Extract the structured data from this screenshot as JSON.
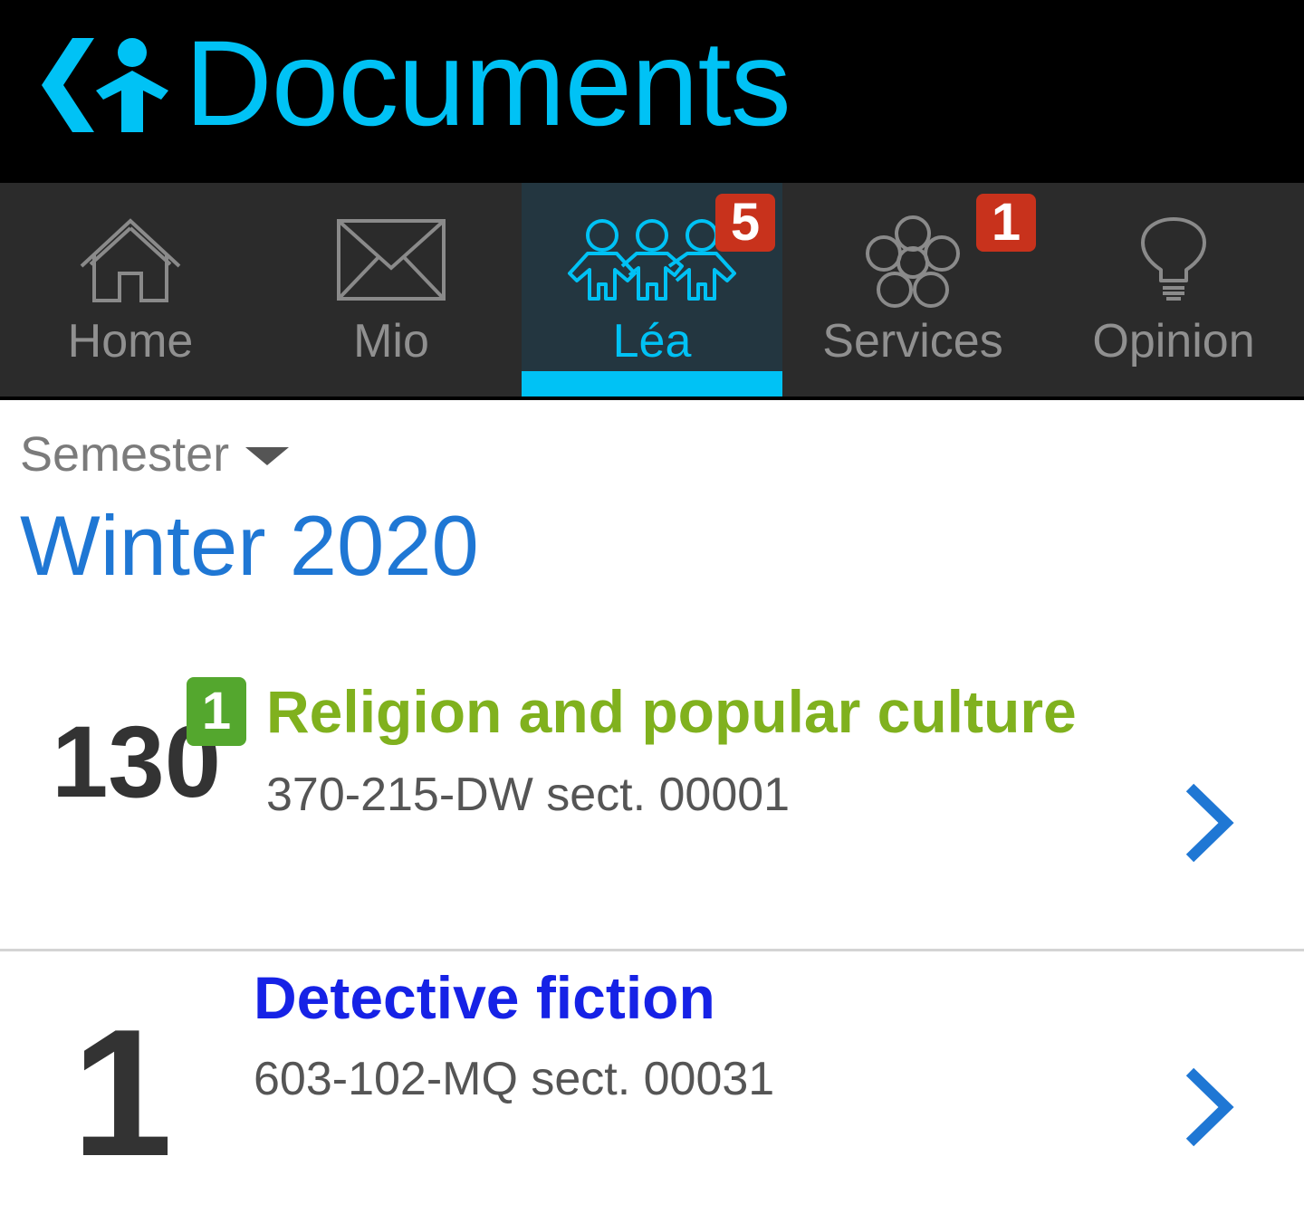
{
  "header": {
    "title": "Documents",
    "logo_icon": "omnivox-logo-icon",
    "title_color": "#00c2f5"
  },
  "tabs": [
    {
      "label": "Home",
      "icon": "house-icon",
      "active": false,
      "badge": null
    },
    {
      "label": "Mio",
      "icon": "envelope-icon",
      "active": false,
      "badge": null
    },
    {
      "label": "Léa",
      "icon": "students-icon",
      "active": true,
      "badge": "5"
    },
    {
      "label": "Services",
      "icon": "flower-icon",
      "active": false,
      "badge": "1"
    },
    {
      "label": "Opinion",
      "icon": "lightbulb-icon",
      "active": false,
      "badge": null
    }
  ],
  "colors": {
    "accent": "#00c2f5",
    "badge_red": "#c8321c",
    "badge_green": "#54a72e",
    "semester_blue": "#1f77d4",
    "course_green": "#80b11e",
    "course_blue": "#1622e6"
  },
  "semester": {
    "label": "Semester",
    "value": "Winter 2020"
  },
  "courses": [
    {
      "count": "130",
      "new_badge": "1",
      "title": "Religion and popular culture",
      "code": "370-215-DW sect. 00001"
    },
    {
      "count": "1",
      "new_badge": null,
      "title": "Detective fiction",
      "code": "603-102-MQ sect. 00031"
    }
  ]
}
